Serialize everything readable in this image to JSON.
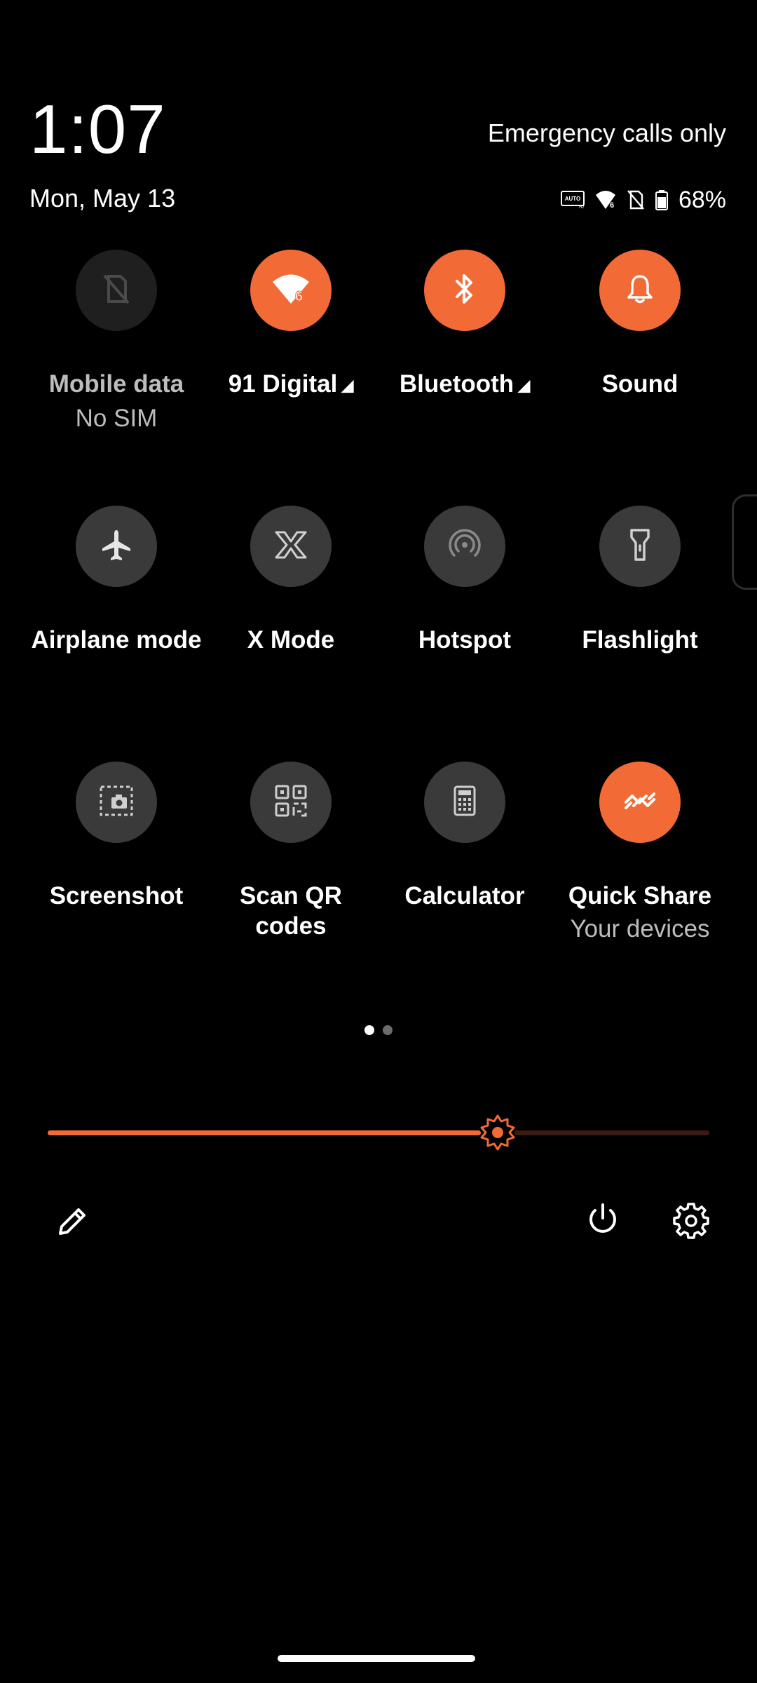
{
  "status": {
    "time": "1:07",
    "date": "Mon, May 13",
    "carrier_text": "Emergency calls only",
    "battery_percent": "68%",
    "battery_level": 0.68,
    "icons": [
      "auto-hz-icon",
      "wifi-6-icon",
      "no-sim-icon",
      "battery-icon"
    ]
  },
  "tiles": [
    {
      "label": "Mobile data",
      "sub": "No SIM",
      "state": "unavailable",
      "icon": "no-sim-icon"
    },
    {
      "label": "91 Digital",
      "state": "on",
      "icon": "wifi-6-icon",
      "has_menu": true
    },
    {
      "label": "Bluetooth",
      "state": "on",
      "icon": "bluetooth-icon",
      "has_menu": true
    },
    {
      "label": "Sound",
      "state": "on",
      "icon": "bell-icon"
    },
    {
      "label": "Airplane mode",
      "state": "off",
      "icon": "airplane-icon"
    },
    {
      "label": "X Mode",
      "state": "off",
      "icon": "x-mode-icon"
    },
    {
      "label": "Hotspot",
      "state": "off",
      "icon": "hotspot-icon"
    },
    {
      "label": "Flashlight",
      "state": "off",
      "icon": "flashlight-icon"
    },
    {
      "label": "Screenshot",
      "state": "off",
      "icon": "screenshot-icon"
    },
    {
      "label": "Scan QR codes",
      "state": "off",
      "icon": "qr-code-icon"
    },
    {
      "label": "Calculator",
      "state": "off",
      "icon": "calculator-icon"
    },
    {
      "label": "Quick Share",
      "sub": "Your devices",
      "state": "on",
      "icon": "quick-share-icon"
    }
  ],
  "pager": {
    "pages": 2,
    "current": 1
  },
  "brightness": {
    "level": 0.68
  },
  "colors": {
    "accent": "#f26a36",
    "tile_off": "#3a3a3a",
    "background": "#000000"
  }
}
